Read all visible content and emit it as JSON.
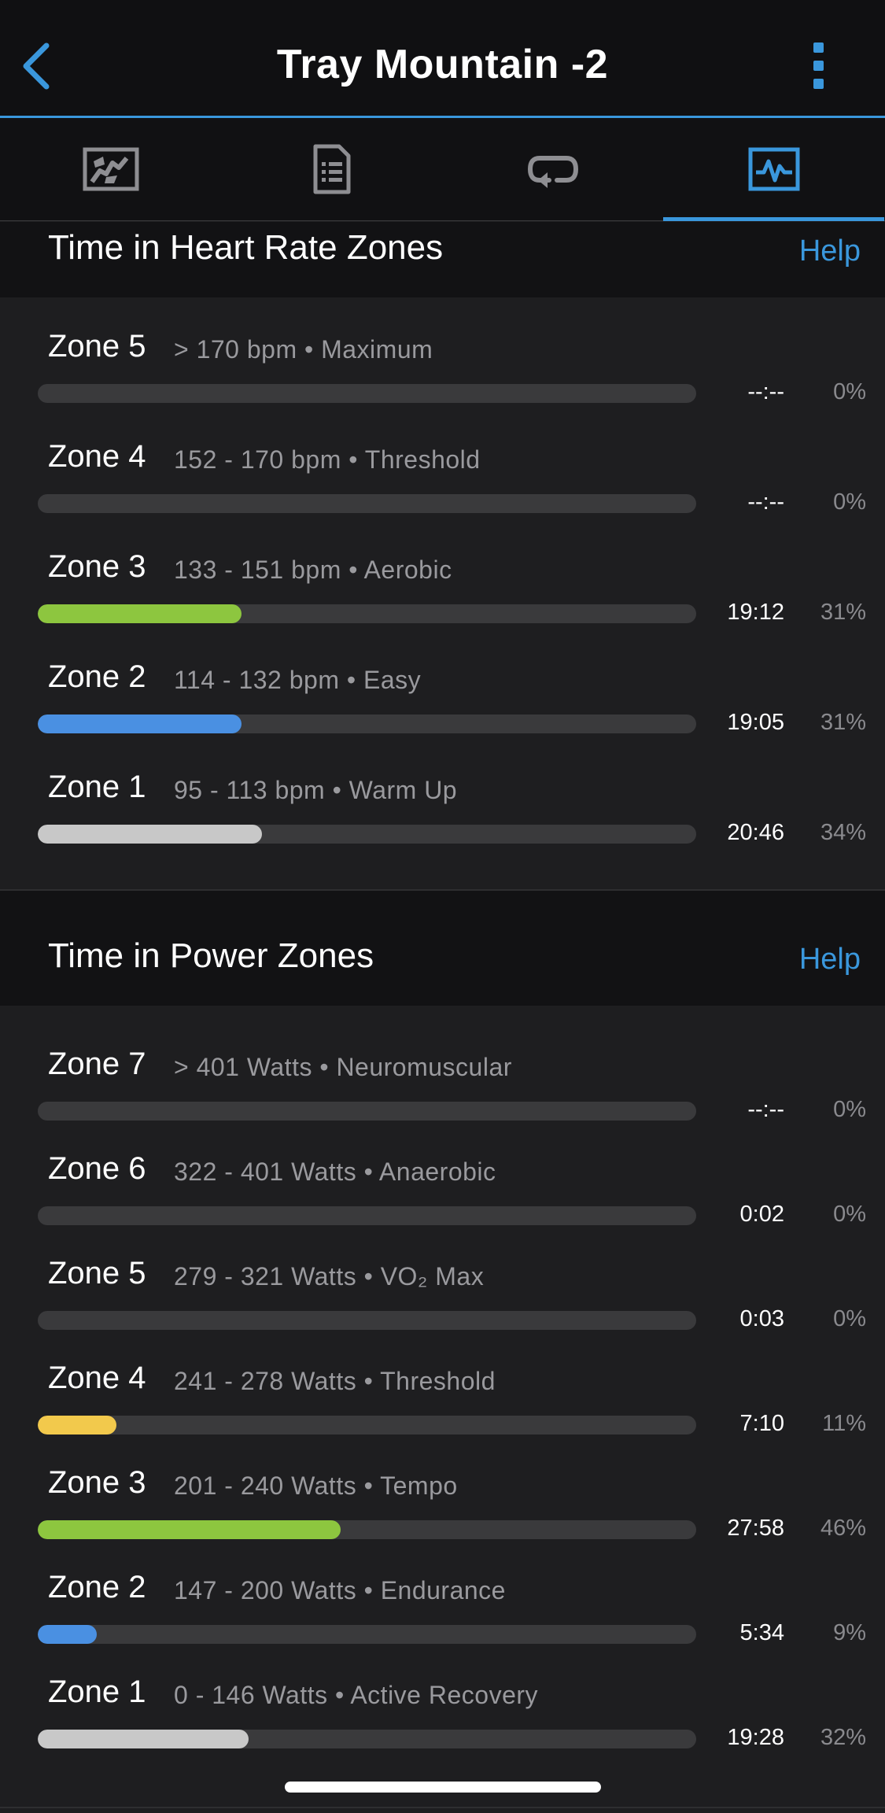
{
  "header": {
    "title": "Tray Mountain -2",
    "back_icon": "chevron-left-icon",
    "more_icon": "more-vertical-icon"
  },
  "tabs": [
    {
      "name": "map",
      "icon": "map-icon",
      "active": false
    },
    {
      "name": "details",
      "icon": "document-list-icon",
      "active": false
    },
    {
      "name": "laps",
      "icon": "laps-loop-icon",
      "active": false
    },
    {
      "name": "stats",
      "icon": "activity-chart-icon",
      "active": true
    }
  ],
  "heart_rate_section": {
    "title": "Time in Heart Rate Zones",
    "help": "Help",
    "zones": [
      {
        "name": "Zone 5",
        "range": "> 170 bpm",
        "label": "Maximum",
        "time": "--:--",
        "percent": "0%",
        "fraction": 0.0,
        "color": "#5a5a5c"
      },
      {
        "name": "Zone 4",
        "range": "152 - 170 bpm",
        "label": "Threshold",
        "time": "--:--",
        "percent": "0%",
        "fraction": 0.0,
        "color": "#5a5a5c"
      },
      {
        "name": "Zone 3",
        "range": "133 - 151 bpm",
        "label": "Aerobic",
        "time": "19:12",
        "percent": "31%",
        "fraction": 0.31,
        "color": "#8dc63f"
      },
      {
        "name": "Zone 2",
        "range": "114 - 132 bpm",
        "label": "Easy",
        "time": "19:05",
        "percent": "31%",
        "fraction": 0.31,
        "color": "#4a90e2"
      },
      {
        "name": "Zone 1",
        "range": "95 - 113 bpm",
        "label": "Warm Up",
        "time": "20:46",
        "percent": "34%",
        "fraction": 0.34,
        "color": "#c8c8c8"
      }
    ]
  },
  "power_section": {
    "title": "Time in Power Zones",
    "help": "Help",
    "zones": [
      {
        "name": "Zone 7",
        "range": "> 401 Watts",
        "label": "Neuromuscular",
        "time": "--:--",
        "percent": "0%",
        "fraction": 0.0,
        "color": "#5a5a5c"
      },
      {
        "name": "Zone 6",
        "range": "322 - 401 Watts",
        "label": "Anaerobic",
        "time": "0:02",
        "percent": "0%",
        "fraction": 0.0,
        "color": "#5a5a5c"
      },
      {
        "name": "Zone 5",
        "range": "279 - 321 Watts",
        "label": "VO₂ Max",
        "time": "0:03",
        "percent": "0%",
        "fraction": 0.0,
        "color": "#5a5a5c"
      },
      {
        "name": "Zone 4",
        "range": "241 - 278 Watts",
        "label": "Threshold",
        "time": "7:10",
        "percent": "11%",
        "fraction": 0.12,
        "color": "#f2c94c"
      },
      {
        "name": "Zone 3",
        "range": "201 - 240 Watts",
        "label": "Tempo",
        "time": "27:58",
        "percent": "46%",
        "fraction": 0.46,
        "color": "#8dc63f"
      },
      {
        "name": "Zone 2",
        "range": "147 - 200 Watts",
        "label": "Endurance",
        "time": "5:34",
        "percent": "9%",
        "fraction": 0.09,
        "color": "#4a90e2"
      },
      {
        "name": "Zone 1",
        "range": "0 - 146 Watts",
        "label": "Active Recovery",
        "time": "19:28",
        "percent": "32%",
        "fraction": 0.32,
        "color": "#c8c8c8"
      }
    ]
  }
}
